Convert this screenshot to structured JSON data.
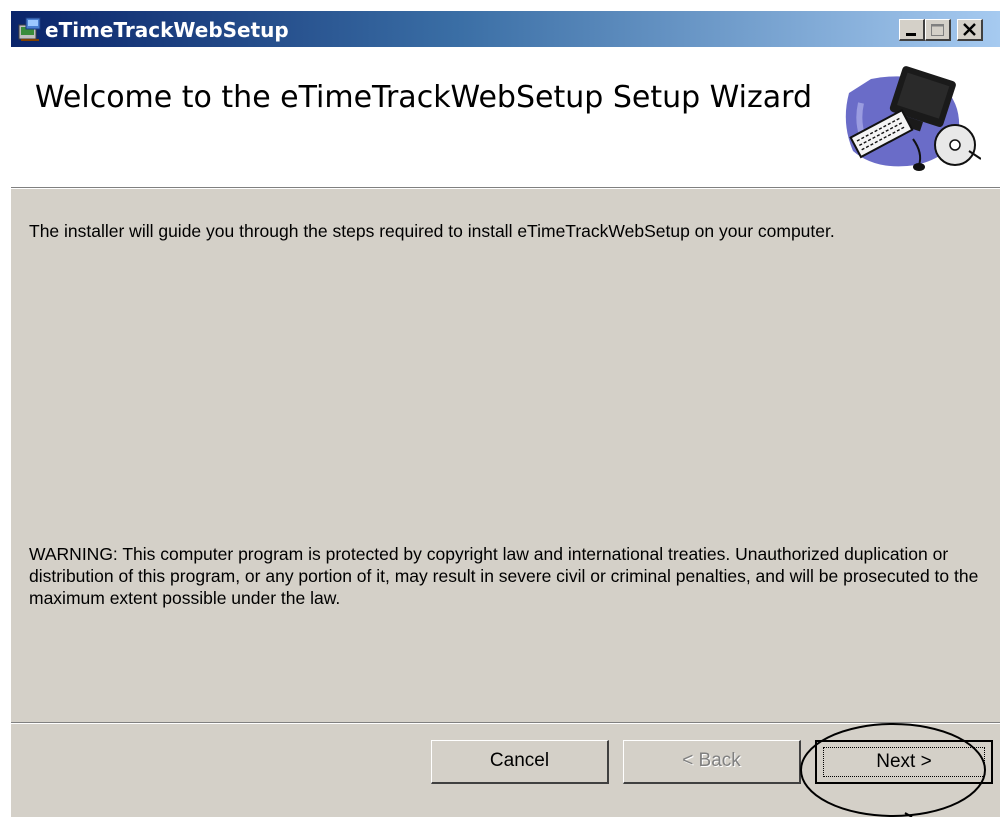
{
  "window": {
    "title": "eTimeTrackWebSetup",
    "controls": [
      "minimize-icon",
      "maximize-icon",
      "close-icon"
    ]
  },
  "banner": {
    "title": "Welcome to the eTimeTrackWebSetup Setup Wizard",
    "art_icon": "computer-setup-icon"
  },
  "body": {
    "intro": "The installer will guide you through the steps required to install eTimeTrackWebSetup on your computer.",
    "warning": "WARNING: This computer program is protected by copyright law and international treaties. Unauthorized duplication or distribution of this program, or any portion of it, may result in severe civil or criminal penalties, and will be prosecuted to the maximum extent possible under the law."
  },
  "buttons": {
    "cancel": "Cancel",
    "back": "< Back",
    "next": "Next >"
  },
  "colors": {
    "titlebar_start": "#0a246a",
    "titlebar_end": "#a6caf0",
    "face": "#d4d0c8"
  }
}
